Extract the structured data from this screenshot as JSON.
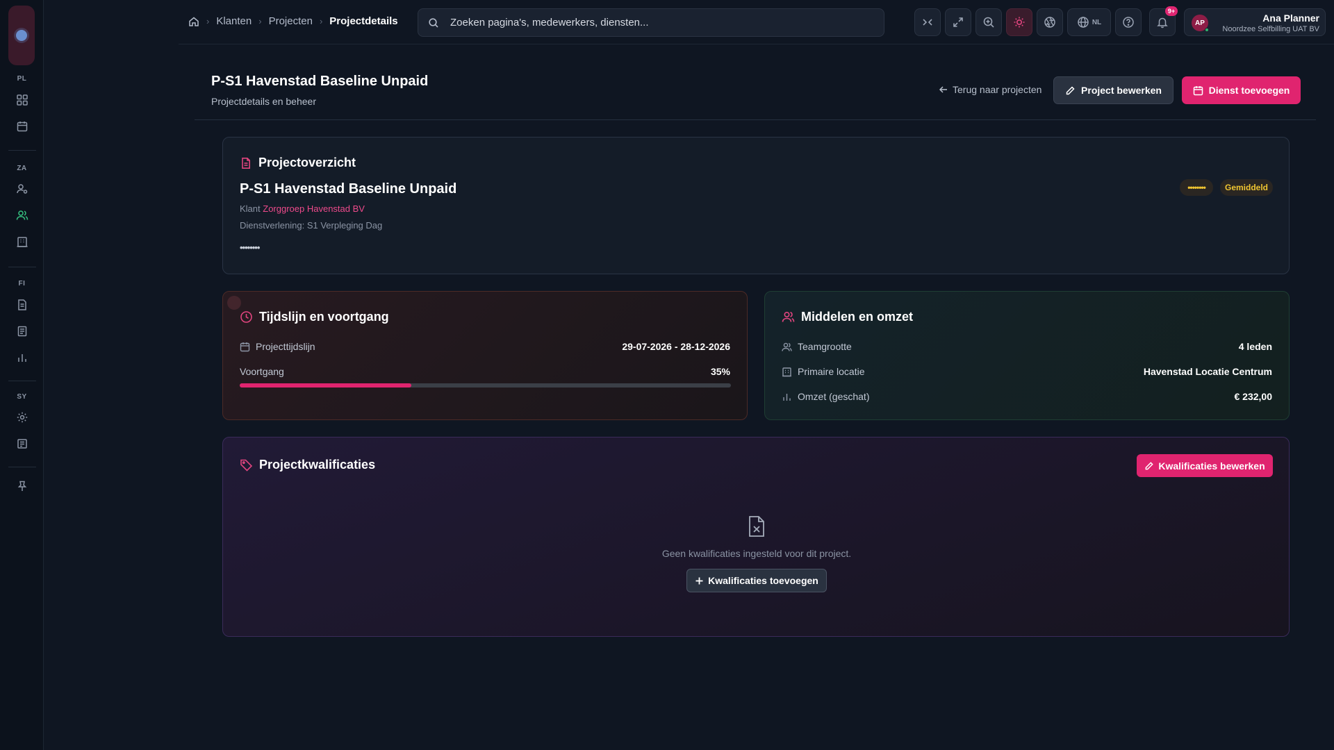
{
  "sidebar": {
    "sections": [
      {
        "label": "PL",
        "items": [
          {
            "icon": "dashboard-grid-icon"
          },
          {
            "icon": "calendar-icon"
          }
        ]
      },
      {
        "label": "ZA",
        "items": [
          {
            "icon": "user-settings-icon"
          },
          {
            "icon": "users-icon",
            "active": true
          },
          {
            "icon": "building-icon"
          }
        ]
      },
      {
        "label": "FI",
        "items": [
          {
            "icon": "document-icon"
          },
          {
            "icon": "receipt-icon"
          },
          {
            "icon": "bar-chart-icon"
          }
        ]
      },
      {
        "label": "SY",
        "items": [
          {
            "icon": "gear-icon"
          },
          {
            "icon": "log-icon"
          }
        ]
      }
    ],
    "pin_icon": "pin-icon"
  },
  "breadcrumb": {
    "items": [
      "Klanten",
      "Projecten"
    ],
    "current": "Projectdetails"
  },
  "search": {
    "placeholder": "Zoeken pagina's, medewerkers, diensten..."
  },
  "topbar": {
    "language": "NL",
    "notification_count": "9+"
  },
  "user": {
    "initials": "AP",
    "name": "Ana Planner",
    "organization": "Noordzee Selfbilling UAT BV"
  },
  "header": {
    "title": "P-S1 Havenstad Baseline Unpaid",
    "subtitle": "Projectdetails en beheer",
    "back_label": "Terug naar projecten",
    "edit_label": "Project bewerken",
    "add_service_label": "Dienst toevoegen"
  },
  "overview": {
    "heading": "Projectoverzicht",
    "project_name": "P-S1 Havenstad Baseline Unpaid",
    "client_label": "Klant",
    "client_name": "Zorggroep Havenstad BV",
    "service_line": "Dienstverlening: S1 Verpleging Dag",
    "masked_description": "••••••••",
    "badge_masked": "••••••••",
    "badge_level": "Gemiddeld"
  },
  "timeline": {
    "heading": "Tijdslijn en voortgang",
    "timeline_label": "Projecttijdslijn",
    "timeline_value": "29-07-2026 - 28-12-2026",
    "progress_label": "Voortgang",
    "progress_value": "35%",
    "progress_fraction": 0.35
  },
  "resources": {
    "heading": "Middelen en omzet",
    "team_label": "Teamgrootte",
    "team_value": "4 leden",
    "location_label": "Primaire locatie",
    "location_value": "Havenstad Locatie Centrum",
    "revenue_label": "Omzet (geschat)",
    "revenue_value": "€ 232,00"
  },
  "qualifications": {
    "heading": "Projectkwalificaties",
    "edit_label": "Kwalificaties bewerken",
    "empty_text": "Geen kwalificaties ingesteld voor dit project.",
    "add_label": "Kwalificaties toevoegen"
  },
  "colors": {
    "accent": "#e0246f",
    "badge_text": "#f0c531",
    "active_nav": "#36c281"
  }
}
